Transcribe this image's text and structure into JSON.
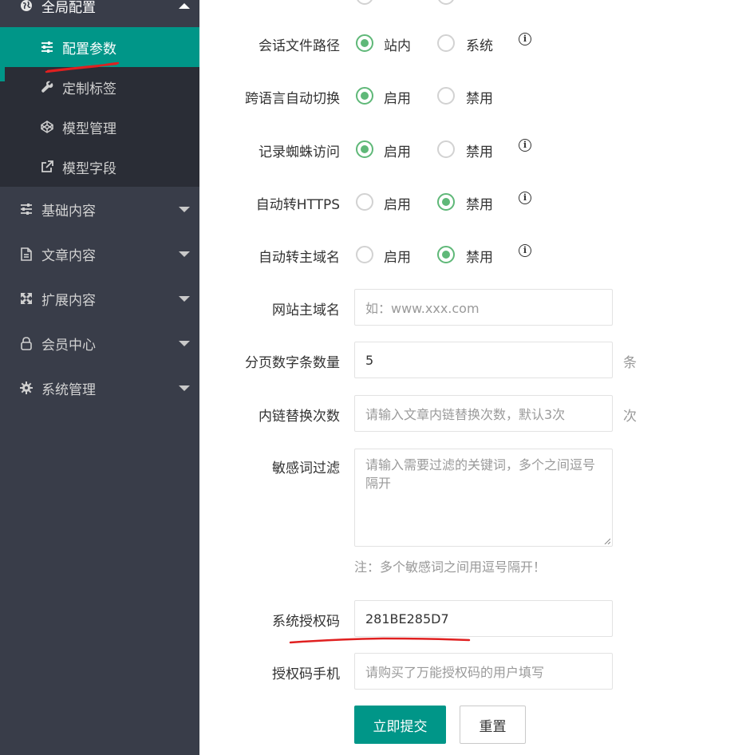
{
  "sidebar": {
    "group_title": "全局配置",
    "sub_items": [
      {
        "label": "配置参数",
        "icon": "sliders-icon",
        "active": true
      },
      {
        "label": "定制标签",
        "icon": "wrench-icon"
      },
      {
        "label": "模型管理",
        "icon": "codepen-icon"
      },
      {
        "label": "模型字段",
        "icon": "external-link-icon"
      }
    ],
    "menus": [
      {
        "label": "基础内容",
        "icon": "sliders-icon"
      },
      {
        "label": "文章内容",
        "icon": "document-icon"
      },
      {
        "label": "扩展内容",
        "icon": "expand-icon"
      },
      {
        "label": "会员中心",
        "icon": "user-icon"
      },
      {
        "label": "系统管理",
        "icon": "gear-icon"
      }
    ]
  },
  "form": {
    "session_path": {
      "label": "会话文件路径",
      "options": [
        "站内",
        "系统"
      ],
      "selected": "站内"
    },
    "lang_switch": {
      "label": "跨语言自动切换",
      "options": [
        "启用",
        "禁用"
      ],
      "selected": "启用"
    },
    "spider_log": {
      "label": "记录蜘蛛访问",
      "options": [
        "启用",
        "禁用"
      ],
      "selected": "启用"
    },
    "auto_https": {
      "label": "自动转HTTPS",
      "options": [
        "启用",
        "禁用"
      ],
      "selected": "禁用"
    },
    "auto_domain": {
      "label": "自动转主域名",
      "options": [
        "启用",
        "禁用"
      ],
      "selected": "禁用"
    },
    "main_domain": {
      "label": "网站主域名",
      "placeholder": "如：www.xxx.com"
    },
    "page_size": {
      "label": "分页数字条数量",
      "value": "5",
      "unit": "条"
    },
    "inner_link": {
      "label": "内链替换次数",
      "placeholder": "请输入文章内链替换次数，默认3次",
      "unit": "次"
    },
    "sensitive": {
      "label": "敏感词过滤",
      "placeholder": "请输入需要过滤的关键词，多个之间逗号隔开",
      "note": "注：多个敏感词之间用逗号隔开！"
    },
    "license_code": {
      "label": "系统授权码",
      "value": "281BE285D7"
    },
    "license_phone": {
      "label": "授权码手机",
      "placeholder": "请购买了万能授权码的用户填写"
    },
    "submit_label": "立即提交",
    "reset_label": "重置"
  },
  "info_symbol": "i",
  "colors": {
    "sidebar_bg": "#393d49",
    "sidebar_sub_bg": "#2a2d36",
    "accent": "#009688",
    "radio_on": "#5fb878",
    "annotation": "#e02020"
  }
}
